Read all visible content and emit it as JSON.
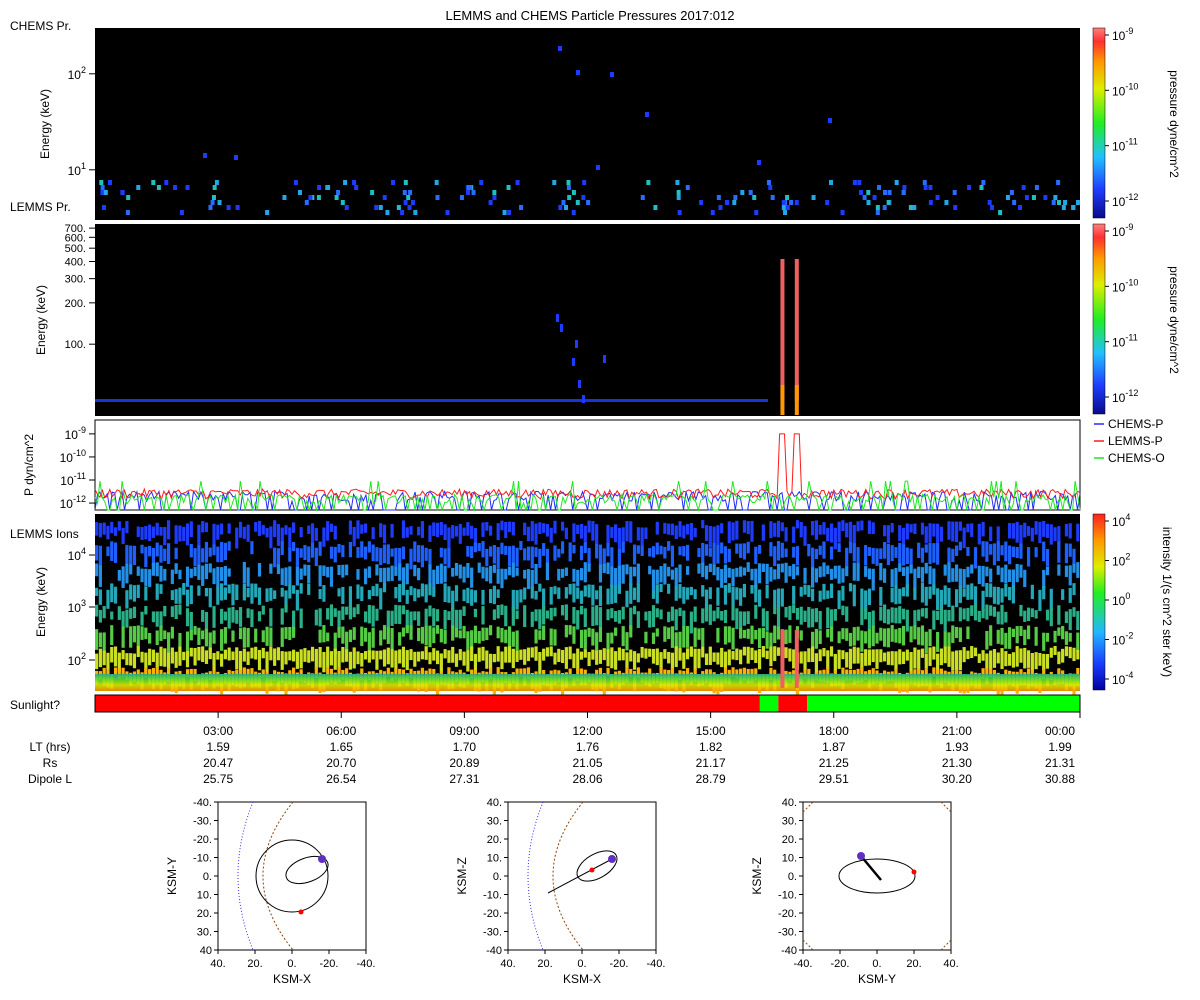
{
  "title": "LEMMS and CHEMS Particle Pressures  2017:012",
  "colors": {
    "panel_bg": "#000000",
    "chems_p": "#1f2cff",
    "lemms_p": "#ff1a1a",
    "chems_o": "#1ee81e",
    "sun_red": "#ff0000",
    "sun_green": "#00ff00"
  },
  "chart_data": [
    {
      "type": "heatmap",
      "label": "CHEMS Pr.",
      "ylabel": "Energy (keV)",
      "y_scale": "log",
      "y_ticks": [
        {
          "v": 10,
          "base": "10",
          "exp": "1"
        },
        {
          "v": 100,
          "base": "10",
          "exp": "2"
        }
      ],
      "y_ylim": [
        3,
        300
      ],
      "x_range_hours": [
        0,
        24
      ],
      "colorbar": {
        "label": "pressure dyne/cm^2",
        "ticks": [
          {
            "base": "10",
            "exp": "-9"
          },
          {
            "base": "10",
            "exp": "-10"
          },
          {
            "base": "10",
            "exp": "-11"
          },
          {
            "base": "10",
            "exp": "-12"
          }
        ]
      }
    },
    {
      "type": "heatmap",
      "label": "LEMMS Pr.",
      "ylabel": "Energy (keV)",
      "y_scale": "log",
      "y_ticks": [
        "700.",
        "600.",
        "500.",
        "400.",
        "300.",
        "200.",
        "100."
      ],
      "y_ylim": [
        30,
        750
      ],
      "spikes_hours": [
        16.75,
        17.1
      ],
      "colorbar": {
        "label": "pressure dyne/cm^2",
        "ticks": [
          {
            "base": "10",
            "exp": "-9"
          },
          {
            "base": "10",
            "exp": "-10"
          },
          {
            "base": "10",
            "exp": "-11"
          },
          {
            "base": "10",
            "exp": "-12"
          }
        ]
      }
    },
    {
      "type": "line",
      "ylabel": "P dyn/cm^2",
      "y_scale": "log",
      "y_ticks": [
        {
          "base": "10",
          "exp": "-9"
        },
        {
          "base": "10",
          "exp": "-10"
        },
        {
          "base": "10",
          "exp": "-11"
        },
        {
          "base": "10",
          "exp": "-12"
        }
      ],
      "ylim": [
        5e-13,
        4e-09
      ],
      "legend_position": "right",
      "series": [
        {
          "name": "CHEMS-P",
          "color": "#1f2cff",
          "typical_value": 2e-12
        },
        {
          "name": "LEMMS-P",
          "color": "#ff1a1a",
          "typical_value": 2.5e-12,
          "peak_value": 1e-09,
          "peak_hours": [
            16.75,
            17.1
          ]
        },
        {
          "name": "CHEMS-O",
          "color": "#1ee81e",
          "typical_value": 1.5e-12
        }
      ]
    },
    {
      "type": "heatmap",
      "label": "LEMMS Ions",
      "ylabel": "Energy (keV)",
      "y_scale": "log",
      "y_ticks": [
        {
          "base": "10",
          "exp": "2"
        },
        {
          "base": "10",
          "exp": "3"
        },
        {
          "base": "10",
          "exp": "4"
        }
      ],
      "colorbar": {
        "label": "intensity 1/(s cm^2 ster keV)",
        "ticks": [
          {
            "base": "10",
            "exp": "4"
          },
          {
            "base": "10",
            "exp": "2"
          },
          {
            "base": "10",
            "exp": "0"
          },
          {
            "base": "10",
            "exp": "-2"
          },
          {
            "base": "10",
            "exp": "-4"
          }
        ]
      }
    },
    {
      "type": "bar",
      "label": "Sunlight?",
      "segments": [
        {
          "start": 0,
          "end": 16.2,
          "state": "red"
        },
        {
          "start": 16.2,
          "end": 16.65,
          "state": "green"
        },
        {
          "start": 16.65,
          "end": 17.35,
          "state": "red"
        },
        {
          "start": 17.35,
          "end": 24,
          "state": "green"
        }
      ]
    }
  ],
  "time_axis": {
    "ticks": [
      "03:00",
      "06:00",
      "09:00",
      "12:00",
      "15:00",
      "18:00",
      "21:00",
      "00:00"
    ],
    "rows": [
      {
        "label": "LT (hrs)",
        "values": [
          "1.59",
          "1.65",
          "1.70",
          "1.76",
          "1.82",
          "1.87",
          "1.93",
          "1.99"
        ]
      },
      {
        "label": "Rs",
        "values": [
          "20.47",
          "20.70",
          "20.89",
          "21.05",
          "21.17",
          "21.25",
          "21.30",
          "21.31"
        ]
      },
      {
        "label": "Dipole L",
        "values": [
          "25.75",
          "26.54",
          "27.31",
          "28.06",
          "28.79",
          "29.51",
          "30.20",
          "30.88"
        ]
      }
    ]
  },
  "orbits": [
    {
      "xlabel": "KSM-X",
      "ylabel": "KSM-Y",
      "yticks": [
        "-40.",
        "-30.",
        "-20.",
        "-10.",
        "0.",
        "10.",
        "20.",
        "30.",
        "40"
      ],
      "xticks": [
        "40.",
        "20.",
        "0.",
        "-20.",
        "-40."
      ]
    },
    {
      "xlabel": "KSM-X",
      "ylabel": "KSM-Z",
      "yticks": [
        "40.",
        "30.",
        "20.",
        "10.",
        "0.",
        "-10.",
        "-20.",
        "-30.",
        "-40"
      ],
      "xticks": [
        "40.",
        "20.",
        "0.",
        "-20.",
        "-40."
      ]
    },
    {
      "xlabel": "KSM-Y",
      "ylabel": "KSM-Z",
      "yticks": [
        "40.",
        "30.",
        "20.",
        "10.",
        "0.",
        "-10.",
        "-20.",
        "-30.",
        "-40"
      ],
      "xticks": [
        "-40.",
        "-20.",
        "0.",
        "20.",
        "40."
      ]
    }
  ]
}
